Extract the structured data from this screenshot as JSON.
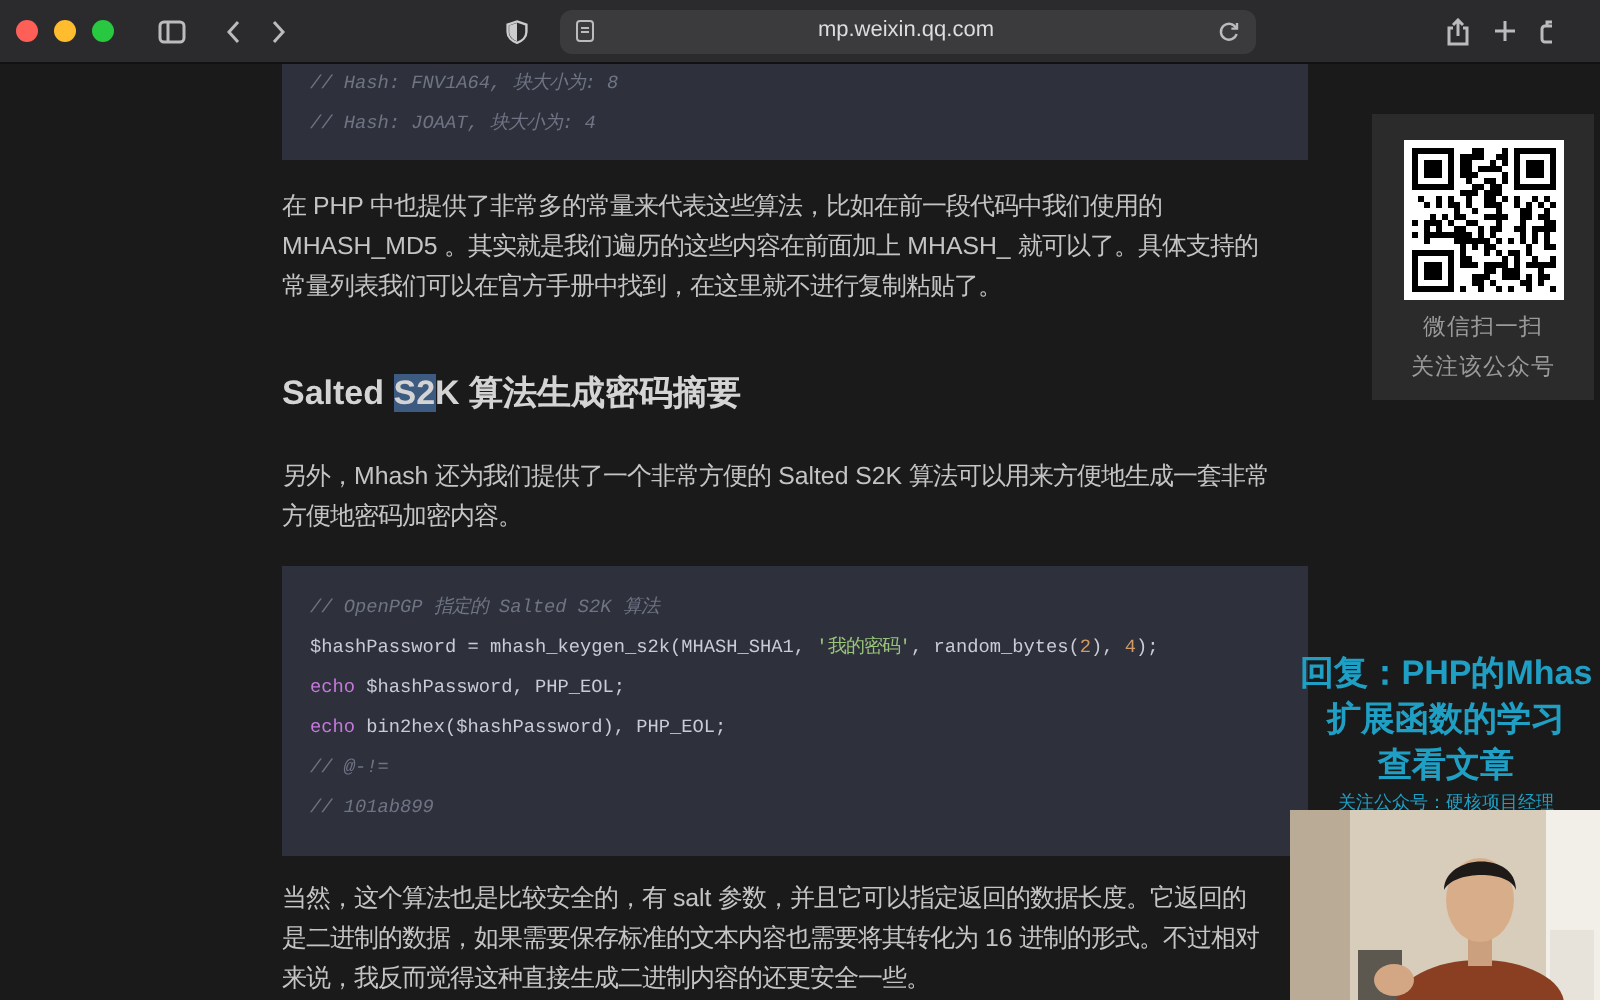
{
  "browser": {
    "url": "mp.weixin.qq.com"
  },
  "article": [
    {
      "kind": "code",
      "lines": [
        [
          {
            "kind": "comment",
            "text": "// Hash: FNV1A64, 块大小为: 8"
          }
        ],
        [
          {
            "kind": "comment",
            "text": "// Hash: JOAAT, 块大小为: 4"
          }
        ]
      ]
    },
    {
      "kind": "paragraph",
      "lines": [
        "在 PHP 中也提供了非常多的常量来代表这些算法，比如在前一段代码中我们使用的",
        "MHASH_MD5 。其实就是我们遍历的这些内容在前面加上 MHASH_ 就可以了。具体支持的",
        "常量列表我们可以在官方手册中找到，在这里就不进行复制粘贴了。"
      ]
    },
    {
      "kind": "heading",
      "segments": [
        {
          "text": "Salted ",
          "selected": false
        },
        {
          "text": "S2",
          "selected": true
        },
        {
          "text": "K 算法生成密码摘要",
          "selected": false
        }
      ]
    },
    {
      "kind": "paragraph",
      "lines": [
        "另外，Mhash 还为我们提供了一个非常方便的 Salted S2K 算法可以用来方便地生成一套非常",
        "方便地密码加密内容。"
      ]
    },
    {
      "kind": "code",
      "lines": [
        [
          {
            "kind": "comment",
            "text": "// OpenPGP 指定的 Salted S2K 算法"
          }
        ],
        [
          {
            "kind": "plain",
            "text": "$hashPassword = mhash_keygen_s2k(MHASH_SHA1, "
          },
          {
            "kind": "string",
            "text": "'我的密码'"
          },
          {
            "kind": "plain",
            "text": ", random_bytes("
          },
          {
            "kind": "number",
            "text": "2"
          },
          {
            "kind": "plain",
            "text": "), "
          },
          {
            "kind": "number",
            "text": "4"
          },
          {
            "kind": "plain",
            "text": ");"
          }
        ],
        [
          {
            "kind": "keyword",
            "text": "echo"
          },
          {
            "kind": "plain",
            "text": " $hashPassword, PHP_EOL;"
          }
        ],
        [
          {
            "kind": "keyword",
            "text": "echo"
          },
          {
            "kind": "plain",
            "text": " bin2hex($hashPassword), PHP_EOL;"
          }
        ],
        [
          {
            "kind": "comment",
            "text": "// @-!="
          }
        ],
        [
          {
            "kind": "comment",
            "text": "// 101ab899"
          }
        ]
      ]
    },
    {
      "kind": "paragraph",
      "lines": [
        "当然，这个算法也是比较安全的，有 salt 参数，并且它可以指定返回的数据长度。它返回的",
        "是二进制的数据，如果需要保存标准的文本内容也需要将其转化为 16 进制的形式。不过相对",
        "来说，我反而觉得这种直接生成二进制内容的还更安全一些。"
      ]
    }
  ],
  "qr_card": {
    "lines": [
      "微信扫一扫",
      "关注该公众号"
    ]
  },
  "promo": {
    "lines": [
      "回复：PHP的Mhas",
      "扩展函数的学习",
      "查看文章"
    ],
    "note": "关注公众号：硬核项目经理"
  }
}
